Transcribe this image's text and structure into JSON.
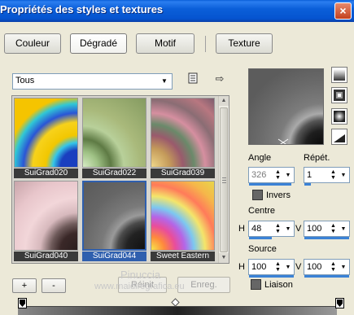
{
  "window": {
    "title": "Propriétés des styles et textures",
    "close_label": "×"
  },
  "tabs": [
    {
      "label": "Couleur"
    },
    {
      "label": "Dégradé"
    },
    {
      "label": "Motif"
    },
    {
      "label": "Texture"
    }
  ],
  "filter": {
    "selected": "Tous"
  },
  "gradients": [
    {
      "name": "SuiGrad020"
    },
    {
      "name": "SuiGrad022"
    },
    {
      "name": "SuiGrad039"
    },
    {
      "name": "SuiGrad040"
    },
    {
      "name": "SuiGrad044",
      "selected": true
    },
    {
      "name": "Sweet Eastern"
    }
  ],
  "buttons": {
    "add": "+",
    "remove": "-",
    "reset": "Réinit",
    "save": "Enreg."
  },
  "angle": {
    "label": "Angle",
    "value": "326"
  },
  "repeat": {
    "label": "Répét.",
    "value": "1"
  },
  "invert": {
    "label": "Invers"
  },
  "centre": {
    "label": "Centre",
    "h_label": "H",
    "h_value": "48",
    "v_label": "V",
    "v_value": "100"
  },
  "source": {
    "label": "Source",
    "h_label": "H",
    "h_value": "100",
    "v_label": "V",
    "v_value": "100"
  },
  "link": {
    "label": "Liaison"
  },
  "watermark": {
    "line1": "Pinuccia",
    "line2": "www.maidiregrafica.eu"
  },
  "colors": {
    "title_blue": "#0554d0",
    "selected_blue": "#2f5fae",
    "face": "#ece9d8"
  }
}
